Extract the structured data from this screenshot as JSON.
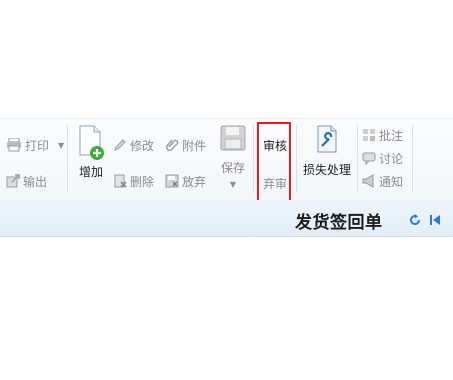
{
  "toolbar": {
    "print": "打印",
    "export": "输出",
    "add": "增加",
    "edit": "修改",
    "attachment": "附件",
    "delete": "删除",
    "discard": "放弃",
    "save": "保存",
    "approve": "审核",
    "reject": "弃审",
    "damage_handling": "损失处理",
    "annotate": "批注",
    "discuss": "讨论",
    "notify": "通知"
  },
  "page": {
    "title": "发货签回单"
  },
  "colors": {
    "highlight_border": "#e41d1d",
    "nav_icon": "#2a7fd4"
  }
}
